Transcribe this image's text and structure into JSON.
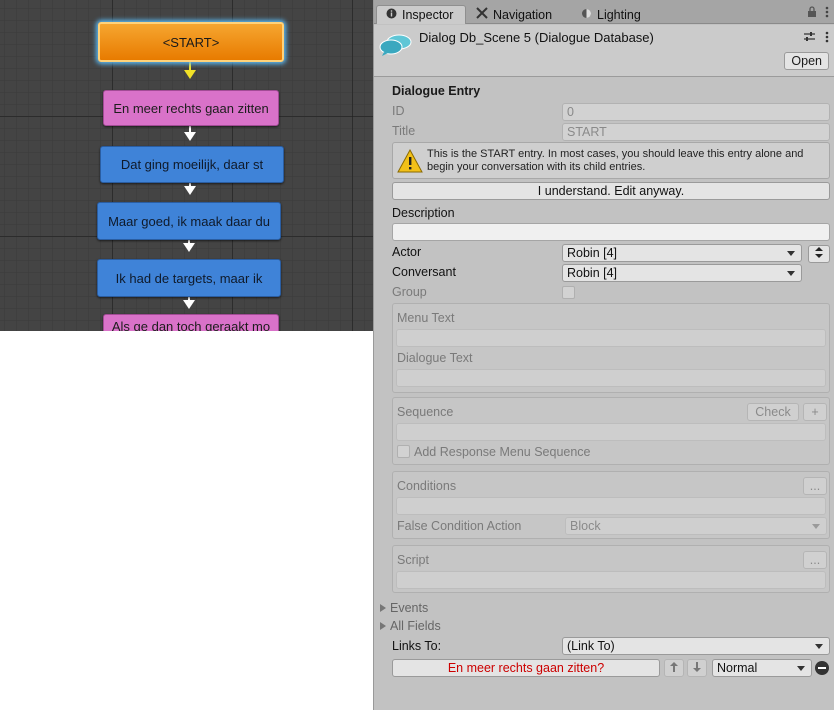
{
  "graph": {
    "nodes": [
      {
        "id": "start",
        "label": "<START>",
        "color": "#e87b00"
      },
      {
        "id": "n1",
        "label": "En meer rechts gaan zitten",
        "color": "#d972c9"
      },
      {
        "id": "n2",
        "label": "Dat ging moeilijk, daar st",
        "color": "#3f83d8"
      },
      {
        "id": "n3",
        "label": "Maar goed, ik maak daar du",
        "color": "#3f83d8"
      },
      {
        "id": "n4",
        "label": "Ik had de targets, maar ik",
        "color": "#3f83d8"
      },
      {
        "id": "n5",
        "label": "Als ge dan toch geraakt mo",
        "color": "#d972c9"
      }
    ]
  },
  "tabs": [
    {
      "label": "Inspector",
      "icon": "info-icon"
    },
    {
      "label": "Navigation",
      "icon": "navigation-icon"
    },
    {
      "label": "Lighting",
      "icon": "lighting-icon"
    }
  ],
  "header": {
    "title": "Dialog Db_Scene 5 (Dialogue Database)",
    "open_label": "Open"
  },
  "entry": {
    "section_title": "Dialogue Entry",
    "id_label": "ID",
    "id_value": "0",
    "title_label": "Title",
    "title_value": "START",
    "warning": "This is the START entry. In most cases, you should leave this entry alone and begin your conversation with its child entries.",
    "understand_label": "I understand. Edit anyway.",
    "description_label": "Description",
    "description_value": "",
    "actor_label": "Actor",
    "actor_value": "Robin [4]",
    "conversant_label": "Conversant",
    "conversant_value": "Robin [4]",
    "group_label": "Group",
    "menu_text_label": "Menu Text",
    "dialogue_text_label": "Dialogue Text",
    "sequence_label": "Sequence",
    "check_label": "Check",
    "plus_label": "+",
    "add_response_label": "Add Response Menu Sequence",
    "conditions_label": "Conditions",
    "ellipsis_label": "...",
    "false_condition_label": "False Condition Action",
    "false_condition_value": "Block",
    "script_label": "Script",
    "events_label": "Events",
    "all_fields_label": "All Fields",
    "links_to_label": "Links To:",
    "links_to_value": "(Link To)",
    "link_entry": "En meer rechts gaan zitten?",
    "link_priority": "Normal",
    "link_entry_color": "#cc0000"
  }
}
